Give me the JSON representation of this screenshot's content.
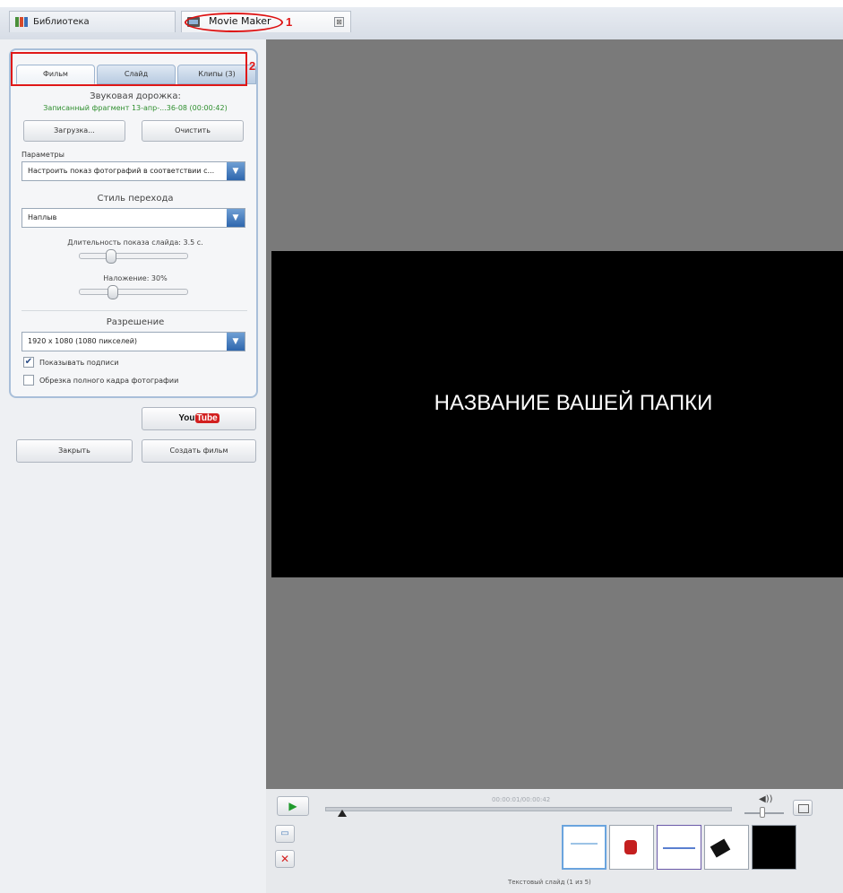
{
  "top_tabs": {
    "library": "Библиотека",
    "movie_maker": "Movie Maker",
    "close_glyph": "⊠"
  },
  "annotations": {
    "one": "1",
    "two": "2"
  },
  "inner_tabs": {
    "film": "Фильм",
    "slide": "Слайд",
    "clips": "Клипы (3)"
  },
  "audio": {
    "title": "Звуковая дорожка:",
    "file": "Записанный фрагмент 13-апр-...36-08 (00:00:42)",
    "load_button": "Загрузка...",
    "clear_button": "Очистить"
  },
  "params": {
    "label": "Параметры",
    "value": "Настроить показ фотографий в соответствии с..."
  },
  "transition": {
    "title": "Стиль перехода",
    "value": "Наплыв",
    "duration_label": "Длительность показа слайда: 3.5 с.",
    "duration_value": 0.35,
    "overlap_label": "Наложение: 30%",
    "overlap_value": 0.3
  },
  "resolution": {
    "title": "Разрешение",
    "value": "1920 x 1080 (1080 пикселей)"
  },
  "options": {
    "show_captions": "Показывать подписи",
    "show_captions_checked": true,
    "crop_full_frame": "Обрезка полного кадра фотографии",
    "crop_full_frame_checked": false
  },
  "youtube": {
    "you": "You",
    "tube": "Tube"
  },
  "actions": {
    "close": "Закрыть",
    "create_movie": "Создать фильм"
  },
  "preview": {
    "slide_text": "НАЗВАНИЕ ВАШЕЙ ПАПКИ"
  },
  "player": {
    "timecode": "00:00:01/00:00:42",
    "play_glyph": "▶",
    "volume_glyph": "◀))",
    "status": "Текстовый слайд   (1 из 5)",
    "delete_glyph": "✕"
  },
  "colors": {
    "accent_red": "#e01818",
    "play_green": "#1f9a2c",
    "panel_border": "#a9bfd9"
  }
}
